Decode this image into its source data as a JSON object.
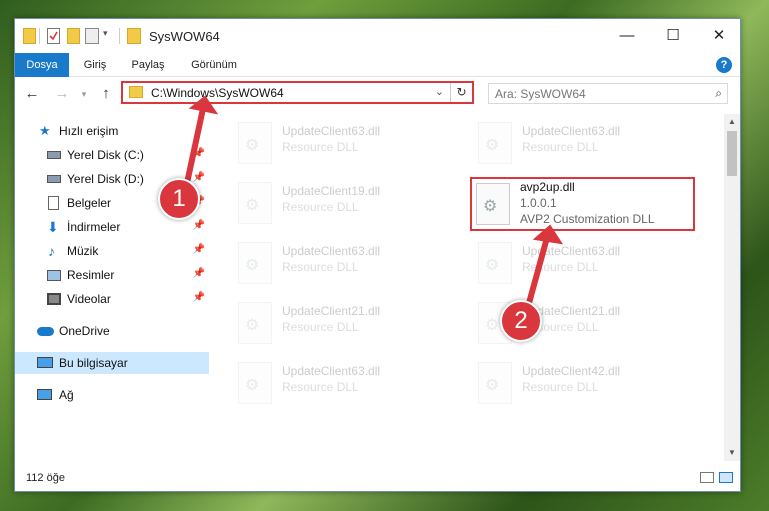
{
  "window": {
    "title": "SysWOW64",
    "minimize": "—",
    "maximize": "☐",
    "close": "✕"
  },
  "ribbon": {
    "tabs": [
      "Dosya",
      "Giriş",
      "Paylaş",
      "Görünüm"
    ],
    "help": "?"
  },
  "nav": {
    "back": "←",
    "forward": "→",
    "up": "↑",
    "address": "C:\\Windows\\SysWOW64",
    "dropdown": "⌄",
    "refresh": "↻",
    "search_placeholder": "Ara: SysWOW64",
    "search_icon": "⌕"
  },
  "sidebar": {
    "items": [
      {
        "label": "Hızlı erişim",
        "icon": "star-icon",
        "pinned": false
      },
      {
        "label": "Yerel Disk (C:)",
        "icon": "drive-icon",
        "pinned": true
      },
      {
        "label": "Yerel Disk (D:)",
        "icon": "drive-icon",
        "pinned": true
      },
      {
        "label": "Belgeler",
        "icon": "document-icon",
        "pinned": true
      },
      {
        "label": "İndirmeler",
        "icon": "download-icon",
        "pinned": true
      },
      {
        "label": "Müzik",
        "icon": "music-icon",
        "pinned": true
      },
      {
        "label": "Resimler",
        "icon": "picture-icon",
        "pinned": true
      },
      {
        "label": "Videolar",
        "icon": "video-icon",
        "pinned": true
      },
      {
        "label": "OneDrive",
        "icon": "cloud-icon",
        "pinned": false
      },
      {
        "label": "Bu bilgisayar",
        "icon": "computer-icon",
        "pinned": false
      },
      {
        "label": "Ağ",
        "icon": "network-icon",
        "pinned": false
      }
    ]
  },
  "files": {
    "faded": [
      {
        "name": "UpdateClient63.dll",
        "type": "Resource DLL"
      },
      {
        "name": "UpdateClient63.dll",
        "type": "Resource DLL"
      },
      {
        "name": "UpdateClient19.dll",
        "type": "Resource DLL"
      },
      {
        "name": "UpdateClient63.dll",
        "type": "Resource DLL"
      },
      {
        "name": "UpdateClient63.dll",
        "type": "Resource DLL"
      },
      {
        "name": "UpdateClient21.dll",
        "type": "Resource DLL"
      },
      {
        "name": "UpdateClient21.dll",
        "type": "Resource DLL"
      },
      {
        "name": "UpdateClient63.dll",
        "type": "Resource DLL"
      },
      {
        "name": "UpdateClient42.dll",
        "type": "Resource DLL"
      }
    ],
    "highlighted": {
      "name": "avp2up.dll",
      "version": "1.0.0.1",
      "description": "AVP2 Customization DLL"
    }
  },
  "status": {
    "item_count": "112 öğe"
  },
  "annotations": {
    "step1": "1",
    "step2": "2",
    "color": "#d9363e"
  }
}
